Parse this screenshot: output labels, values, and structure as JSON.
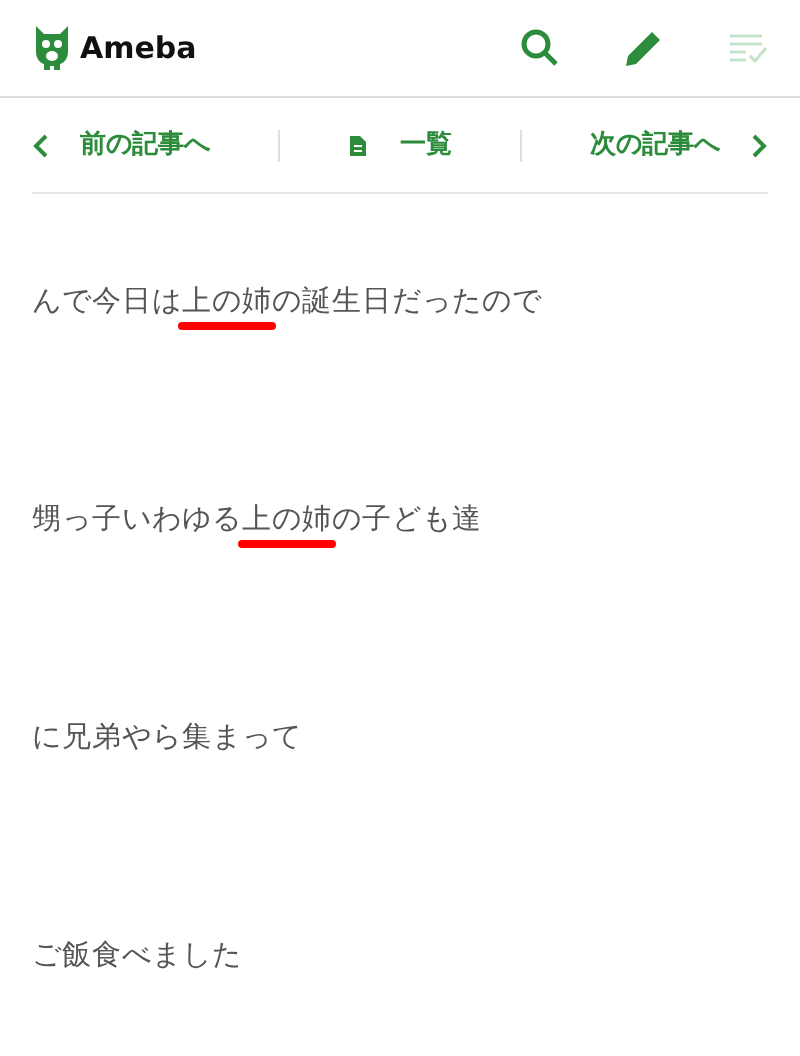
{
  "header": {
    "logo": "Ameba"
  },
  "article_nav": {
    "previous": "前の記事へ",
    "list": "一覧",
    "next": "次の記事へ"
  },
  "paragraphs": [
    {
      "before": "んで今日は",
      "marked": "上の姉",
      "after": "の誕生日だったので"
    },
    {
      "before": "甥っ子いわゆる",
      "marked": "上の姉",
      "after": "の子ども達"
    },
    {
      "before": "に兄弟やら集まって"
    },
    {
      "before": "ご飯食べました"
    }
  ]
}
